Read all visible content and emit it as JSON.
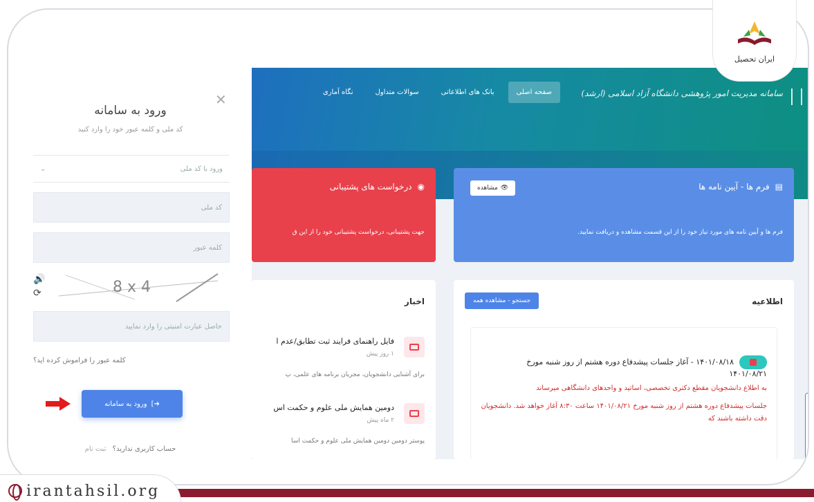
{
  "branding": {
    "logo_text": "ایران تحصیل",
    "site_url": "irantahsil.org"
  },
  "login": {
    "title": "ورود به سامانه",
    "subtitle": "کد ملی و کلمه عبور خود را وارد کنید",
    "login_type": "ورود با کد ملی",
    "national_code_placeholder": "کد ملی",
    "password_placeholder": "کلمه عبور",
    "captcha_text": "8 x 4",
    "captcha_placeholder": "حاصل عبارت امنیتی را وارد نمایید",
    "forgot_password": "کلمه عبور را فراموش کرده اید؟",
    "login_button": "ورود به سامانه",
    "no_account": "حساب کاربری ندارید؟",
    "register": "ثبت نام"
  },
  "site": {
    "brand": "سامانه مدیریت امور پژوهشی دانشگاه آزاد اسلامی (ارشد)",
    "nav": [
      {
        "label": "صفحه اصلی",
        "active": true
      },
      {
        "label": "بانک های اطلاعاتی",
        "active": false
      },
      {
        "label": "سوالات متداول",
        "active": false
      },
      {
        "label": "نگاه آماری",
        "active": false
      }
    ],
    "forms_card": {
      "title": "فرم ها - آیین نامه ها",
      "view_label": "مشاهده",
      "body": "فرم ها و آیین نامه های مورد نیاز خود را از این قسمت مشاهده و دریافت نمایید."
    },
    "support_card": {
      "title": "درخواست های پشتیبانی",
      "body": "جهت پشتیبانی، درخواست پشتیبانی خود را از این ق"
    },
    "notice": {
      "title": "اطلاعیه",
      "search_label": "جستجو - مشاهده همه",
      "item_title": "۱۴۰۱/۰۸/۱۸ - آغاز جلسات پیشدفاع دوره هشتم از روز شنبه مورخ",
      "item_date": "۱۴۰۱/۰۸/۲۱",
      "item_line1": "به اطلاع دانشجویان مقطع دکتری تخصصی، اساتید و واحدهای دانشگاهی میرساند",
      "item_line2": "جلسات پیشدفاع دوره هشتم از روز شنبه مورخ ۱۴۰۱/۰۸/۲۱ ساعت ۸:۳۰ آغاز خواهد شد. دانشجویان دقت داشته باشند که"
    },
    "news": {
      "title": "اخبار",
      "items": [
        {
          "title": "فایل راهنمای فرایند ثبت تطابق/عدم ا",
          "time": "۱ روز پیش",
          "desc": "برای آشنایی دانشجویان، مجریان برنامه های علمی، پ"
        },
        {
          "title": "دومین همایش ملی علوم و حکمت اس",
          "time": "۲ ماه پیش",
          "desc": "پوستر دومین دومین همایش ملی علوم و حکمت اسا"
        }
      ]
    }
  }
}
